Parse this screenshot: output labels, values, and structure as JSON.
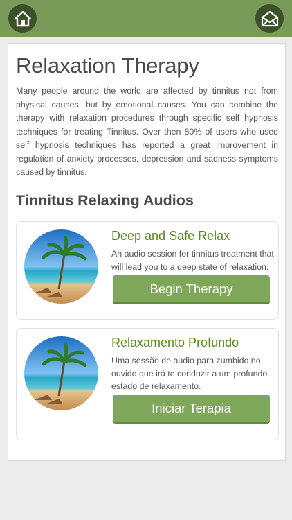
{
  "header": {
    "home_icon": "home-icon",
    "mail_icon": "mail-icon",
    "accent": "#7a9a5a"
  },
  "page": {
    "title": "Relaxation Therapy",
    "intro": "Many people around the world are affected by tinnitus not from physical causes, but by emotional causes. You can combine the therapy with relaxation procedures through specific self hypnosis techniques for treating Tinnitus. Over then 80% of users who used self hypnosis techniques has reported a great improvement in regulation of anxiety processes, depression and sadness symptoms caused by tinnitus.",
    "section_title": "Tinnitus Relaxing Audios"
  },
  "audios": [
    {
      "title": "Deep and Safe Relax",
      "description": "An audio session for tinnitus treatment that will lead you to a deep state of relaxation.",
      "button": "Begin Therapy"
    },
    {
      "title": "Relaxamento Profundo",
      "description": "Uma sessão de audio para zumbido no ouvido que irá te conduzir a um profundo estado de relaxamento.",
      "button": "Iniciar Terapia"
    }
  ],
  "colors": {
    "title_green": "#5a8a1e",
    "button_green": "#7ea75a"
  }
}
